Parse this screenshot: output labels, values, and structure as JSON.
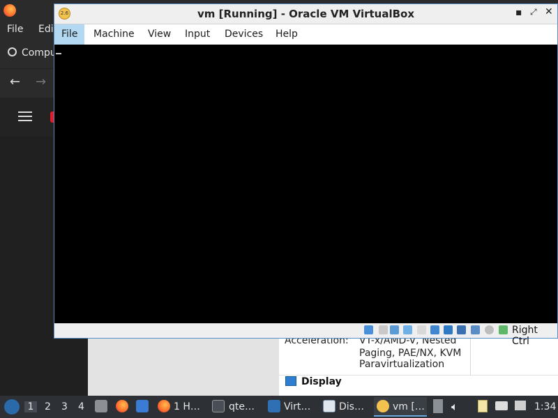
{
  "background_app": {
    "menu": [
      "File",
      "Edi"
    ],
    "bookmark_label": "Compu",
    "vm_details": {
      "acceleration_label": "Acceleration:",
      "acceleration_value_lines": [
        "VT-x/AMD-V, Nested",
        "Paging, PAE/NX, KVM",
        "Paravirtualization"
      ],
      "display_header": "Display"
    }
  },
  "vbox": {
    "title": "vm [Running] - Oracle VM VirtualBox",
    "menu": [
      "File",
      "Machine",
      "View",
      "Input",
      "Devices",
      "Help"
    ],
    "active_menu": "File",
    "host_key_label": "Right Ctrl"
  },
  "taskbar": {
    "workspaces": [
      "1",
      "2",
      "3",
      "4"
    ],
    "active_workspace": "1",
    "tasks": [
      {
        "label": "1 H…",
        "icon": "firefox-icon"
      },
      {
        "label": "qte…",
        "icon": "terminal-icon"
      },
      {
        "label": "Virt…",
        "icon": "virtualbox-icon"
      },
      {
        "label": "Dis…",
        "icon": "window-icon"
      },
      {
        "label": "vm […",
        "icon": "vm-icon",
        "active": true
      }
    ],
    "clock": "1:34"
  },
  "colors": {
    "accent": "#b3d9f2",
    "taskbar_bg": "#2d3136",
    "window_border": "#5a8dc6"
  }
}
